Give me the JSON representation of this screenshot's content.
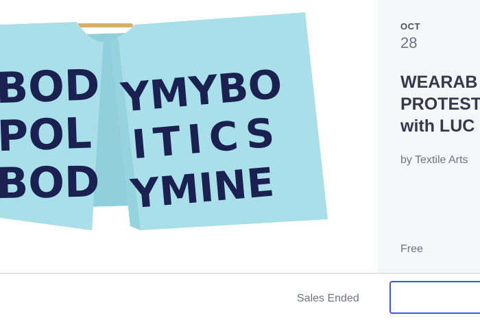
{
  "event": {
    "month": "OCT",
    "day": "28",
    "title_lines": [
      "WEARAB",
      "PROTEST",
      "with LUC"
    ],
    "organizer": "by Textile Arts",
    "price": "Free"
  },
  "hero_image": {
    "felt_lettering": [
      "BOD",
      "POL",
      "BOD",
      "YMYBO",
      "ITICS",
      "YMINE"
    ],
    "colors": {
      "felt": "#a9dfe8",
      "letters": "#1a2050",
      "dowel": "#d8ae68"
    }
  },
  "footer": {
    "sales_status": "Sales Ended",
    "button_label": ""
  },
  "colors": {
    "accent": "#3659e3",
    "panel_bg": "#f5f6f8",
    "title": "#39364f",
    "muted": "#6f7287"
  }
}
